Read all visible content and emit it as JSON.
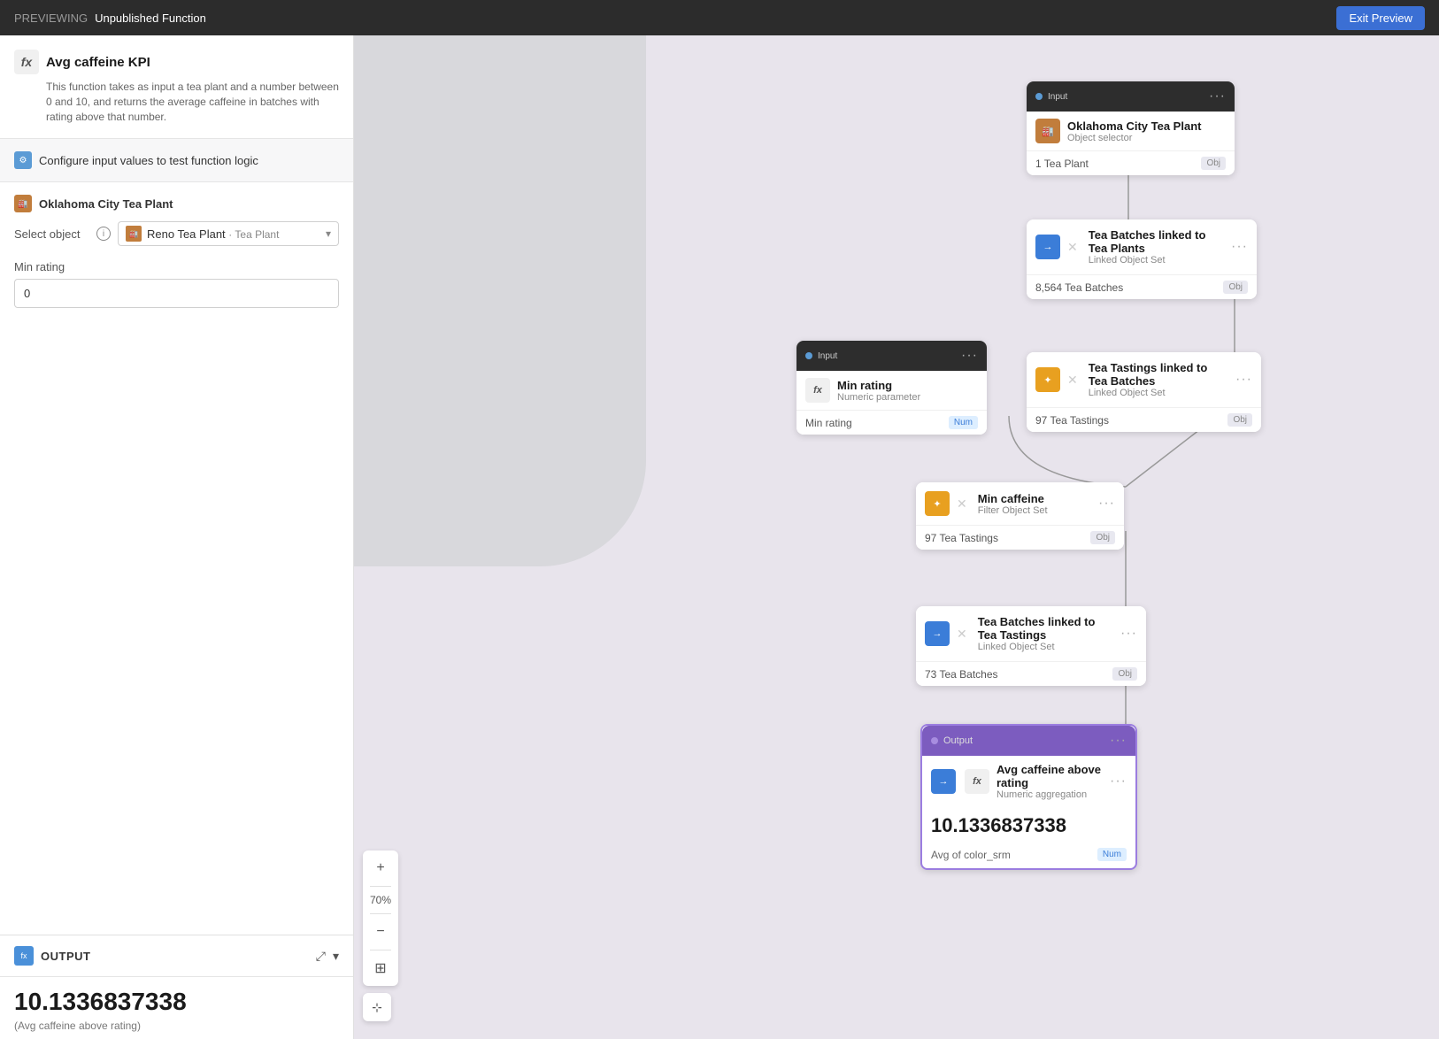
{
  "topbar": {
    "previewing_label": "PREVIEWING",
    "function_name": "Unpublished Function",
    "exit_button_label": "Exit Preview"
  },
  "left_panel": {
    "function": {
      "fx_label": "fx",
      "title": "Avg caffeine KPI",
      "description": "This function takes as input a tea plant and a number between 0 and 10, and returns the average caffeine in batches with rating above that number."
    },
    "configure": {
      "label": "Configure input values to test function logic",
      "icon_label": "⚙"
    },
    "input_object": {
      "group_name": "Oklahoma City Tea Plant",
      "select_label": "Select object",
      "selected_value": "Reno Tea Plant",
      "selected_type": "· Tea Plant"
    },
    "min_rating": {
      "label": "Min rating",
      "value": "0",
      "placeholder": "0"
    },
    "output": {
      "section_label": "OUTPUT",
      "value": "10.1336837338",
      "sublabel": "(Avg caffeine above rating)"
    }
  },
  "canvas": {
    "nodes": {
      "input_node": {
        "header_label": "Input",
        "title": "Oklahoma City Tea Plant",
        "subtitle": "Object selector",
        "count": "1 Tea Plant",
        "badge": "Obj"
      },
      "tea_batches_node": {
        "title": "Tea Batches linked to Tea Plants",
        "subtitle": "Linked Object Set",
        "count": "8,564 Tea Batches",
        "badge": "Obj"
      },
      "tea_tastings_node": {
        "title": "Tea Tastings linked to Tea Batches",
        "subtitle": "Linked Object Set",
        "count": "97 Tea Tastings",
        "badge": "Obj"
      },
      "min_rating_input": {
        "header_label": "Input",
        "title": "Min rating",
        "subtitle": "Numeric parameter",
        "footer_label": "Min rating",
        "badge": "Num"
      },
      "min_caffeine_node": {
        "title": "Min caffeine",
        "subtitle": "Filter Object Set",
        "count": "97 Tea Tastings",
        "badge": "Obj"
      },
      "tea_batches_linked": {
        "title": "Tea Batches linked to Tea Tastings",
        "subtitle": "Linked Object Set",
        "count": "73 Tea Batches",
        "badge": "Obj"
      },
      "output_node": {
        "header_label": "Output",
        "title": "Avg caffeine above rating",
        "subtitle": "Numeric aggregation",
        "value": "10.1336837338",
        "footer_label": "Avg of color_srm",
        "badge": "Num"
      }
    },
    "zoom_level": "70%",
    "zoom_in": "+",
    "zoom_out": "−"
  }
}
